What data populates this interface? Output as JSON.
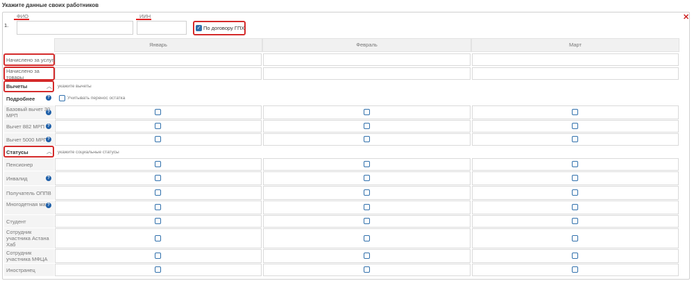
{
  "page_title": "Укажите данные своих работников",
  "employee_number": "1.",
  "fields": {
    "fio_label": "ФИО",
    "iin_label": "ИИН",
    "fio_value": "",
    "iin_value": ""
  },
  "gpx": {
    "label": "По договору ГПХ",
    "checked": true
  },
  "months": [
    "Январь",
    "Февраль",
    "Март"
  ],
  "accrued": {
    "services": "Начислено за услуги",
    "goods": "Начислено за товары"
  },
  "deductions": {
    "title": "Вычеты",
    "hint": "укажите вычеты",
    "details_label": "Подробнее",
    "carryover_label": "Учитывать перенос остатка",
    "rows": [
      "Базовый вычет 30 МРП",
      "Вычет 882 МРП",
      "Вычет 5000 МРП"
    ]
  },
  "statuses": {
    "title": "Статусы",
    "hint": "укажите социальные статусы",
    "rows": [
      "Пенсионер",
      "Инвалид",
      "Получатель ОППВ",
      "Многодетная мать",
      "Студент",
      "Сотрудник участника Астана Хаб",
      "Сотрудник участника МФЦА",
      "Иностранец"
    ]
  },
  "icons": {
    "close": "close-icon",
    "check": "check-icon",
    "chevron": "chevron-up-icon",
    "info": "question-info-icon"
  },
  "colors": {
    "accent": "#2f6fab",
    "highlight": "#d42a2a"
  }
}
